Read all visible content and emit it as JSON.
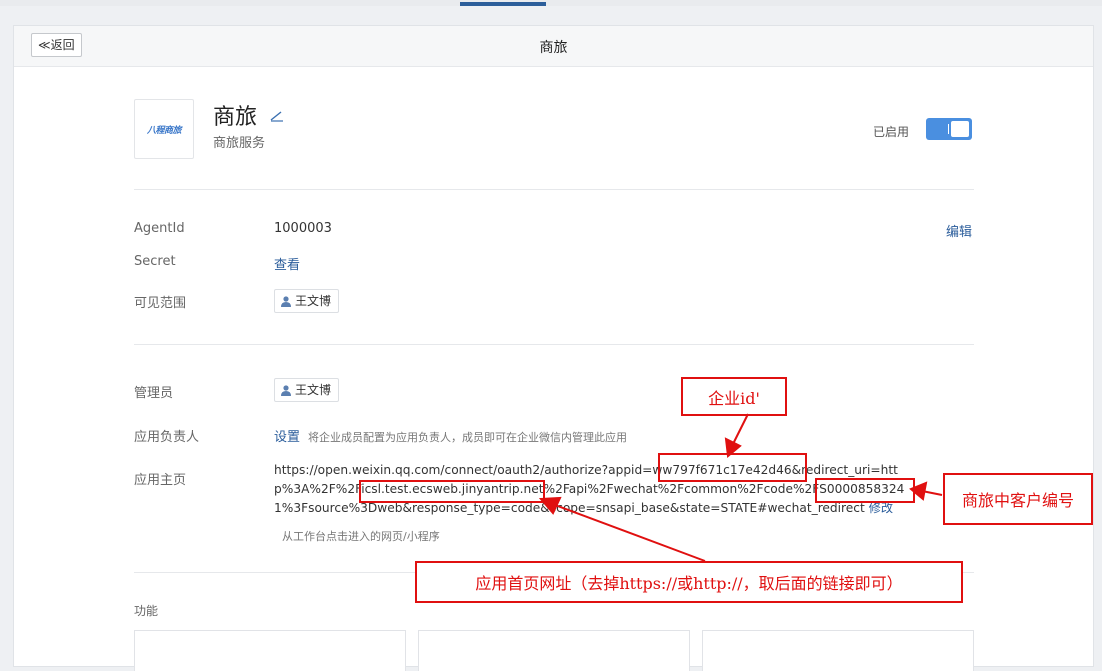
{
  "window": {
    "title": "商旅"
  },
  "header": {
    "back_label": "≪返回",
    "title": "商旅"
  },
  "app": {
    "logo_text": "八程商旅",
    "name": "商旅",
    "description": "商旅服务",
    "status_label": "已启用",
    "enabled": true
  },
  "details": {
    "agentid_label": "AgentId",
    "agentid_value": "1000003",
    "edit_label": "编辑",
    "secret_label": "Secret",
    "secret_link": "查看",
    "visible_label": "可见范围",
    "visible_user": "王文博"
  },
  "admin": {
    "admin_label": "管理员",
    "admin_user": "王文博",
    "owner_label": "应用负责人",
    "owner_link": "设置",
    "owner_hint": "将企业成员配置为应用负责人，成员即可在企业微信内管理此应用",
    "home_label": "应用主页",
    "home_url_lines": [
      "https://open.weixin.qq.com/connect/oauth2/authorize?appid=ww797f671c17e42d46&redirect_uri=htt",
      "p%3A%2F%2Ficsl.test.ecsweb.jinyantrip.net%2Fapi%2Fwechat%2Fcommon%2Fcode%2FS0000858324",
      "1%3Fsource%3Dweb&response_type=code&scope=snsapi_base&state=STATE#wechat_redirect"
    ],
    "home_modify_link": "修改",
    "home_sub": "从工作台点击进入的网页/小程序"
  },
  "features": {
    "label": "功能"
  },
  "annotations": {
    "corp_id": "企业id'",
    "customer_no": "商旅中客户编号",
    "homepage_note": "应用首页网址（去掉https://或http://，取后面的链接即可）"
  },
  "colors": {
    "accent": "#4a8fe0",
    "link": "#2b5d9b",
    "annotation": "#e01010"
  },
  "icons": [
    "edit-pen-icon",
    "person-icon",
    "toggle-switch"
  ]
}
